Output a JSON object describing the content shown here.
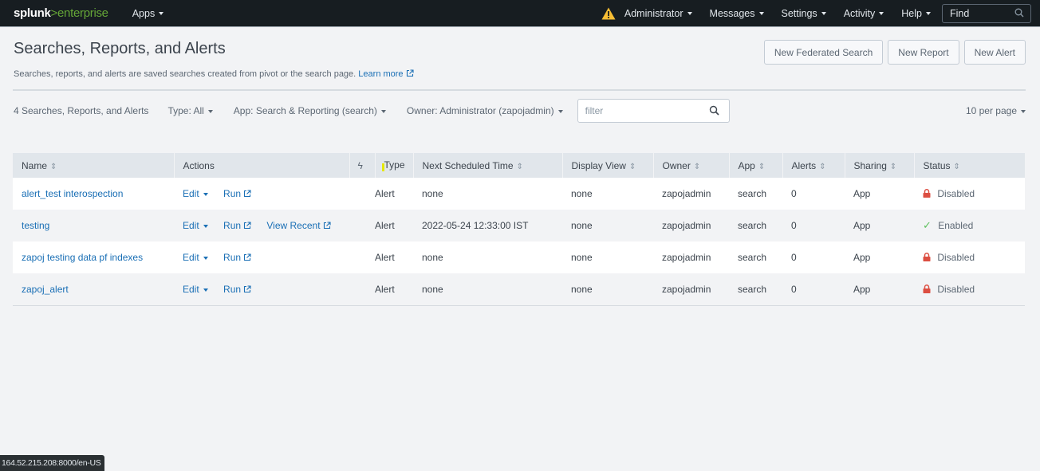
{
  "topbar": {
    "logo_main": "splunk",
    "logo_sep": ">",
    "logo_product": "enterprise",
    "apps_label": "Apps",
    "menus": [
      {
        "label": "Administrator",
        "name": "administrator"
      },
      {
        "label": "Messages",
        "name": "messages"
      },
      {
        "label": "Settings",
        "name": "settings"
      },
      {
        "label": "Activity",
        "name": "activity"
      },
      {
        "label": "Help",
        "name": "help"
      }
    ],
    "find_placeholder": "Find",
    "warning_color": "#f8be34"
  },
  "header": {
    "title": "Searches, Reports, and Alerts",
    "description": "Searches, reports, and alerts are saved searches created from pivot or the search page.",
    "learn_more": "Learn more",
    "buttons": {
      "new_federated_search": "New Federated Search",
      "new_report": "New Report",
      "new_alert": "New Alert"
    }
  },
  "filters": {
    "count_label": "4 Searches, Reports, and Alerts",
    "type": "Type: All",
    "app": "App: Search & Reporting (search)",
    "owner": "Owner: Administrator (zapojadmin)",
    "filter_placeholder": "filter",
    "per_page": "10 per page"
  },
  "table": {
    "columns": {
      "name": "Name",
      "actions": "Actions",
      "lightning": "ϟ",
      "type": "Type",
      "next_scheduled": "Next Scheduled Time",
      "display_view": "Display View",
      "owner": "Owner",
      "app": "App",
      "alerts": "Alerts",
      "sharing": "Sharing",
      "status": "Status"
    },
    "sort_glyph": "⇕",
    "action_labels": {
      "edit": "Edit",
      "run": "Run",
      "view_recent": "View Recent"
    },
    "rows": [
      {
        "name": "alert_test interospection",
        "has_view_recent": false,
        "type": "Alert",
        "next_scheduled": "none",
        "display_view": "none",
        "owner": "zapojadmin",
        "app": "search",
        "alerts": "0",
        "sharing": "App",
        "status": "Disabled"
      },
      {
        "name": "testing",
        "has_view_recent": true,
        "type": "Alert",
        "next_scheduled": "2022-05-24 12:33:00 IST",
        "display_view": "none",
        "owner": "zapojadmin",
        "app": "search",
        "alerts": "0",
        "sharing": "App",
        "status": "Enabled"
      },
      {
        "name": "zapoj testing data pf indexes",
        "has_view_recent": false,
        "type": "Alert",
        "next_scheduled": "none",
        "display_view": "none",
        "owner": "zapojadmin",
        "app": "search",
        "alerts": "0",
        "sharing": "App",
        "status": "Disabled"
      },
      {
        "name": "zapoj_alert",
        "has_view_recent": false,
        "type": "Alert",
        "next_scheduled": "none",
        "display_view": "none",
        "owner": "zapojadmin",
        "app": "search",
        "alerts": "0",
        "sharing": "App",
        "status": "Disabled"
      }
    ],
    "status_colors": {
      "disabled": "#dc4e41",
      "enabled": "#5cc05c"
    }
  },
  "statusbar": {
    "url": "164.52.215.208:8000/en-US"
  }
}
